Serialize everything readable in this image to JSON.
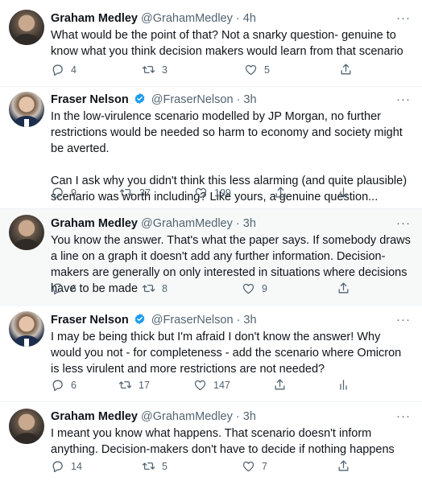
{
  "icons": {
    "reply": "reply-icon",
    "retweet": "retweet-icon",
    "like": "heart-icon",
    "share": "share-icon",
    "analytics": "analytics-icon",
    "more": "more-icon",
    "verified": "verified-badge-icon"
  },
  "colors": {
    "text": "#0f1419",
    "muted": "#536471",
    "verified": "#1d9bf0",
    "highlight_bg": "#f7f9f9"
  },
  "tweets": [
    {
      "name": "Graham Medley",
      "handle": "@GrahamMedley",
      "time": "· 4h",
      "more": "···",
      "text": "What would be the point of that? Not a snarky question- genuine to know what you think decision makers would learn from that scenario",
      "replies": "4",
      "retweets": "3",
      "likes": "5"
    },
    {
      "name": "Fraser Nelson",
      "handle": "@FraserNelson",
      "time": "· 3h",
      "more": "···",
      "text": "In the low-virulence scenario modelled by JP Morgan, no further restrictions would be needed so harm to economy and society might be averted.\n\nCan I ask why you didn't think this less alarming (and quite plausible) scenario was worth including? Like yours, a genuine question...",
      "replies": "9",
      "retweets": "37",
      "likes": "199"
    },
    {
      "name": "Graham Medley",
      "handle": "@GrahamMedley",
      "time": "· 3h",
      "more": "···",
      "text": "You know the answer. That's what the paper says. If somebody draws a line on a graph it doesn't add any further information. Decision-makers are generally on only interested in situations where decisions have to be made",
      "replies": "6",
      "retweets": "8",
      "likes": "9"
    },
    {
      "name": "Fraser Nelson",
      "handle": "@FraserNelson",
      "time": "· 3h",
      "more": "···",
      "text": "I may be being thick but I'm afraid I don't know the answer! Why would you not - for completeness - add the scenario where Omicron is less virulent and more restrictions are not needed?",
      "replies": "6",
      "retweets": "17",
      "likes": "147"
    },
    {
      "name": "Graham Medley",
      "handle": "@GrahamMedley",
      "time": "· 3h",
      "more": "···",
      "text": "I meant you know what happens. That scenario doesn't inform anything. Decision-makers don't have to decide if nothing happens",
      "replies": "14",
      "retweets": "5",
      "likes": "7"
    }
  ]
}
